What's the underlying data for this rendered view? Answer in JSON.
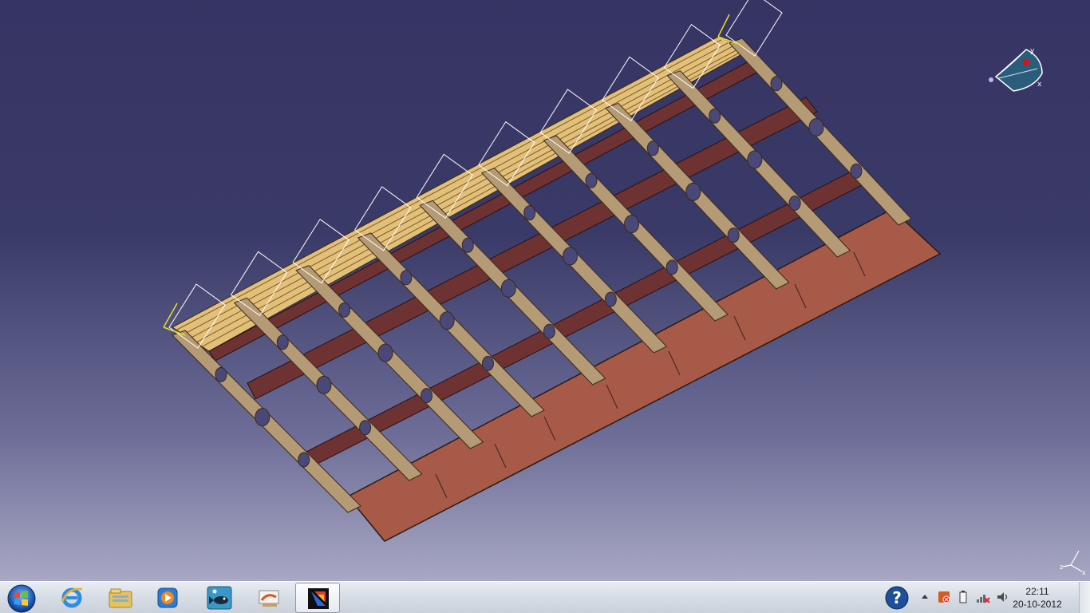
{
  "viewport": {
    "background_top": "#363463",
    "background_bottom": "#a8a8c4",
    "model": "aircraft-wing-structure",
    "colors": {
      "rib": "#b59a76",
      "rib_edge": "#3a2a18",
      "spar": "#6e3232",
      "flap": "#a85a48",
      "leading_edge": "#e3c078",
      "wireframe": "#ffffff",
      "highlight": "#e8e020"
    },
    "compass_icon": "compass-icon",
    "axis_icon": "axis-triad-icon",
    "axis_labels": {
      "x": "x",
      "y": "y",
      "z": "z"
    }
  },
  "taskbar": {
    "start_icon": "windows-start-icon",
    "pinned": [
      {
        "name": "internet-explorer",
        "icon": "ie-icon"
      },
      {
        "name": "windows-explorer",
        "icon": "folder-icon"
      },
      {
        "name": "media-player",
        "icon": "media-player-icon"
      },
      {
        "name": "fish-app",
        "icon": "fish-icon"
      },
      {
        "name": "paint-app",
        "icon": "paint-icon"
      },
      {
        "name": "catia",
        "icon": "catia-icon",
        "active": true
      }
    ],
    "tray": {
      "help_icon": "help-icon",
      "expand_icon": "tray-expand-icon",
      "icons": [
        "security-icon",
        "battery-icon",
        "network-icon",
        "volume-icon"
      ]
    },
    "clock": {
      "time": "22:11",
      "date": "20-10-2012"
    }
  }
}
